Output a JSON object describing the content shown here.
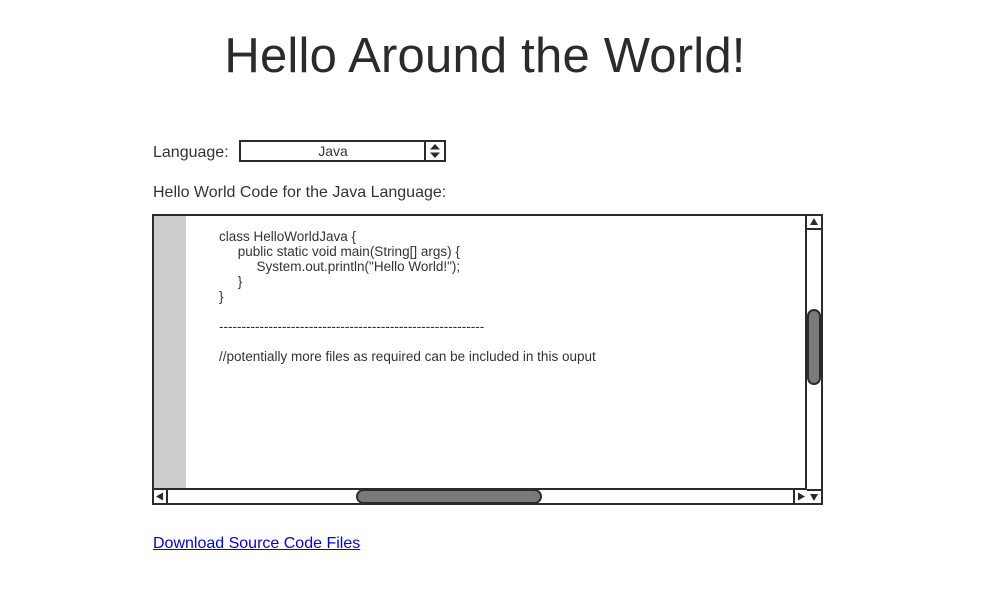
{
  "header": {
    "title": "Hello Around the World!"
  },
  "language_selector": {
    "label": "Language:",
    "selected_value": "Java",
    "spinner_icon": "up-down-spinner-icon"
  },
  "code_section": {
    "heading": "Hello World Code for the Java Language:",
    "code_text": "class HelloWorldJava {\n     public static void main(String[] args) {\n          System.out.println(\"Hello World!\");\n     }\n}\n\n-----------------------------------------------------------\n\n//potentially more files as required can be included in this ouput"
  },
  "scrollbars": {
    "vertical": {
      "up_icon": "arrow-up-icon",
      "down_icon": "arrow-down-icon"
    },
    "horizontal": {
      "left_icon": "arrow-left-icon",
      "right_icon": "arrow-right-icon"
    }
  },
  "footer": {
    "download_link_label": "Download Source Code Files"
  },
  "colors": {
    "text": "#2b2b2b",
    "link": "#0000ee",
    "gutter": "#cccccc",
    "scroll_thumb": "#7a7a7a",
    "border": "#2b2b2b"
  }
}
